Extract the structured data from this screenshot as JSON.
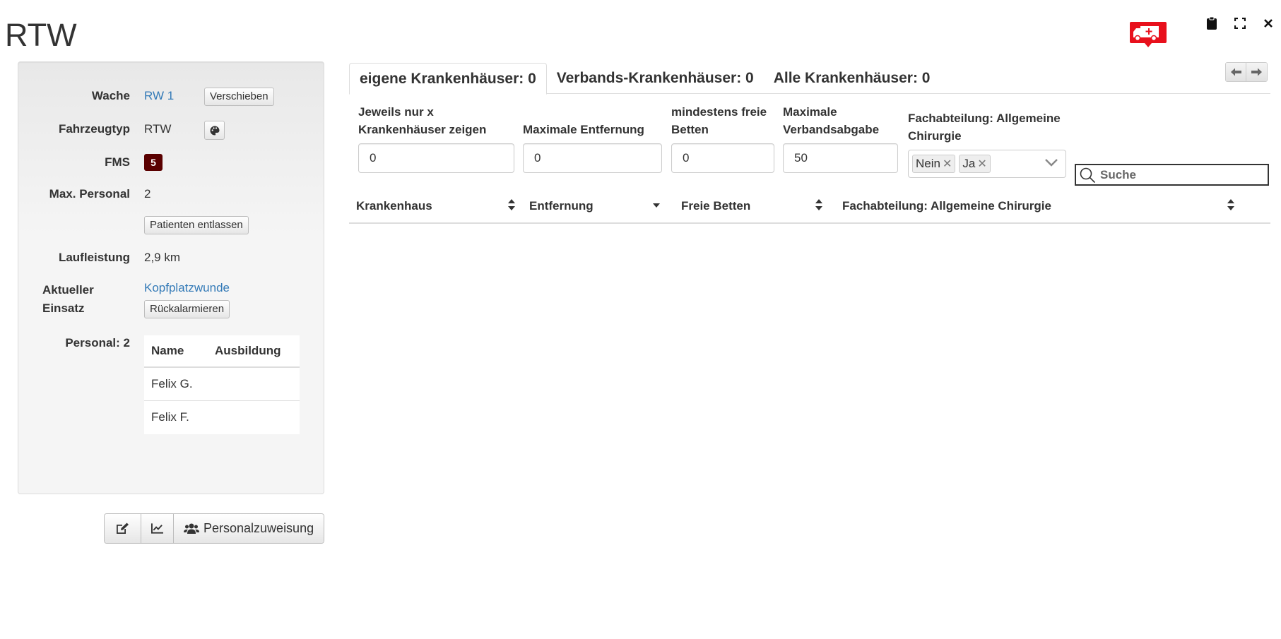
{
  "page": {
    "title": "RTW"
  },
  "vehicle": {
    "wache_label": "Wache",
    "wache_value": "RW 1",
    "move_button": "Verschieben",
    "type_label": "Fahrzeugtyp",
    "type_value": "RTW",
    "fms_label": "FMS",
    "fms_value": "5",
    "max_personal_label": "Max. Personal",
    "max_personal_value": "2",
    "release_patients_button": "Patienten entlassen",
    "mileage_label": "Laufleistung",
    "mileage_value": "2,9 km",
    "mission_label_1": "Aktueller",
    "mission_label_2": "Einsatz",
    "mission_value": "Kopfplatzwunde",
    "recall_button": "Rückalarmieren",
    "crew_label": "Personal: 2",
    "crew_headers": [
      "Name",
      "Ausbildung"
    ],
    "crew": [
      {
        "name": "Felix G.",
        "training": ""
      },
      {
        "name": "Felix F.",
        "training": ""
      }
    ]
  },
  "actions": {
    "staffing_button": "Personalzuweisung"
  },
  "tabs": [
    {
      "label": "eigene Krankenhäuser: 0"
    },
    {
      "label": "Verbands-Krankenhäuser: 0"
    },
    {
      "label": "Alle Krankenhäuser: 0"
    }
  ],
  "filters": {
    "limit_label_1": "Jeweils nur x",
    "limit_label_2": "Krankenhäuser zeigen",
    "limit_value": "0",
    "distance_label": "Maximale Entfernung",
    "distance_value": "0",
    "beds_label_1": "mindestens freie",
    "beds_label_2": "Betten",
    "beds_value": "0",
    "fee_label_1": "Maximale",
    "fee_label_2": "Verbandsabgabe",
    "fee_value": "50",
    "department_label_1": "Fachabteilung: Allgemeine",
    "department_label_2": "Chirurgie",
    "department_chips": [
      "Nein",
      "Ja"
    ],
    "search_placeholder": "Suche"
  },
  "hospital_table": {
    "headers": [
      "Krankenhaus",
      "Entfernung",
      "Freie Betten",
      "Fachabteilung: Allgemeine Chirurgie"
    ]
  },
  "colors": {
    "accent": "#337ab7",
    "fms_badge": "#5a0000",
    "marker_red": "#e8101c"
  }
}
